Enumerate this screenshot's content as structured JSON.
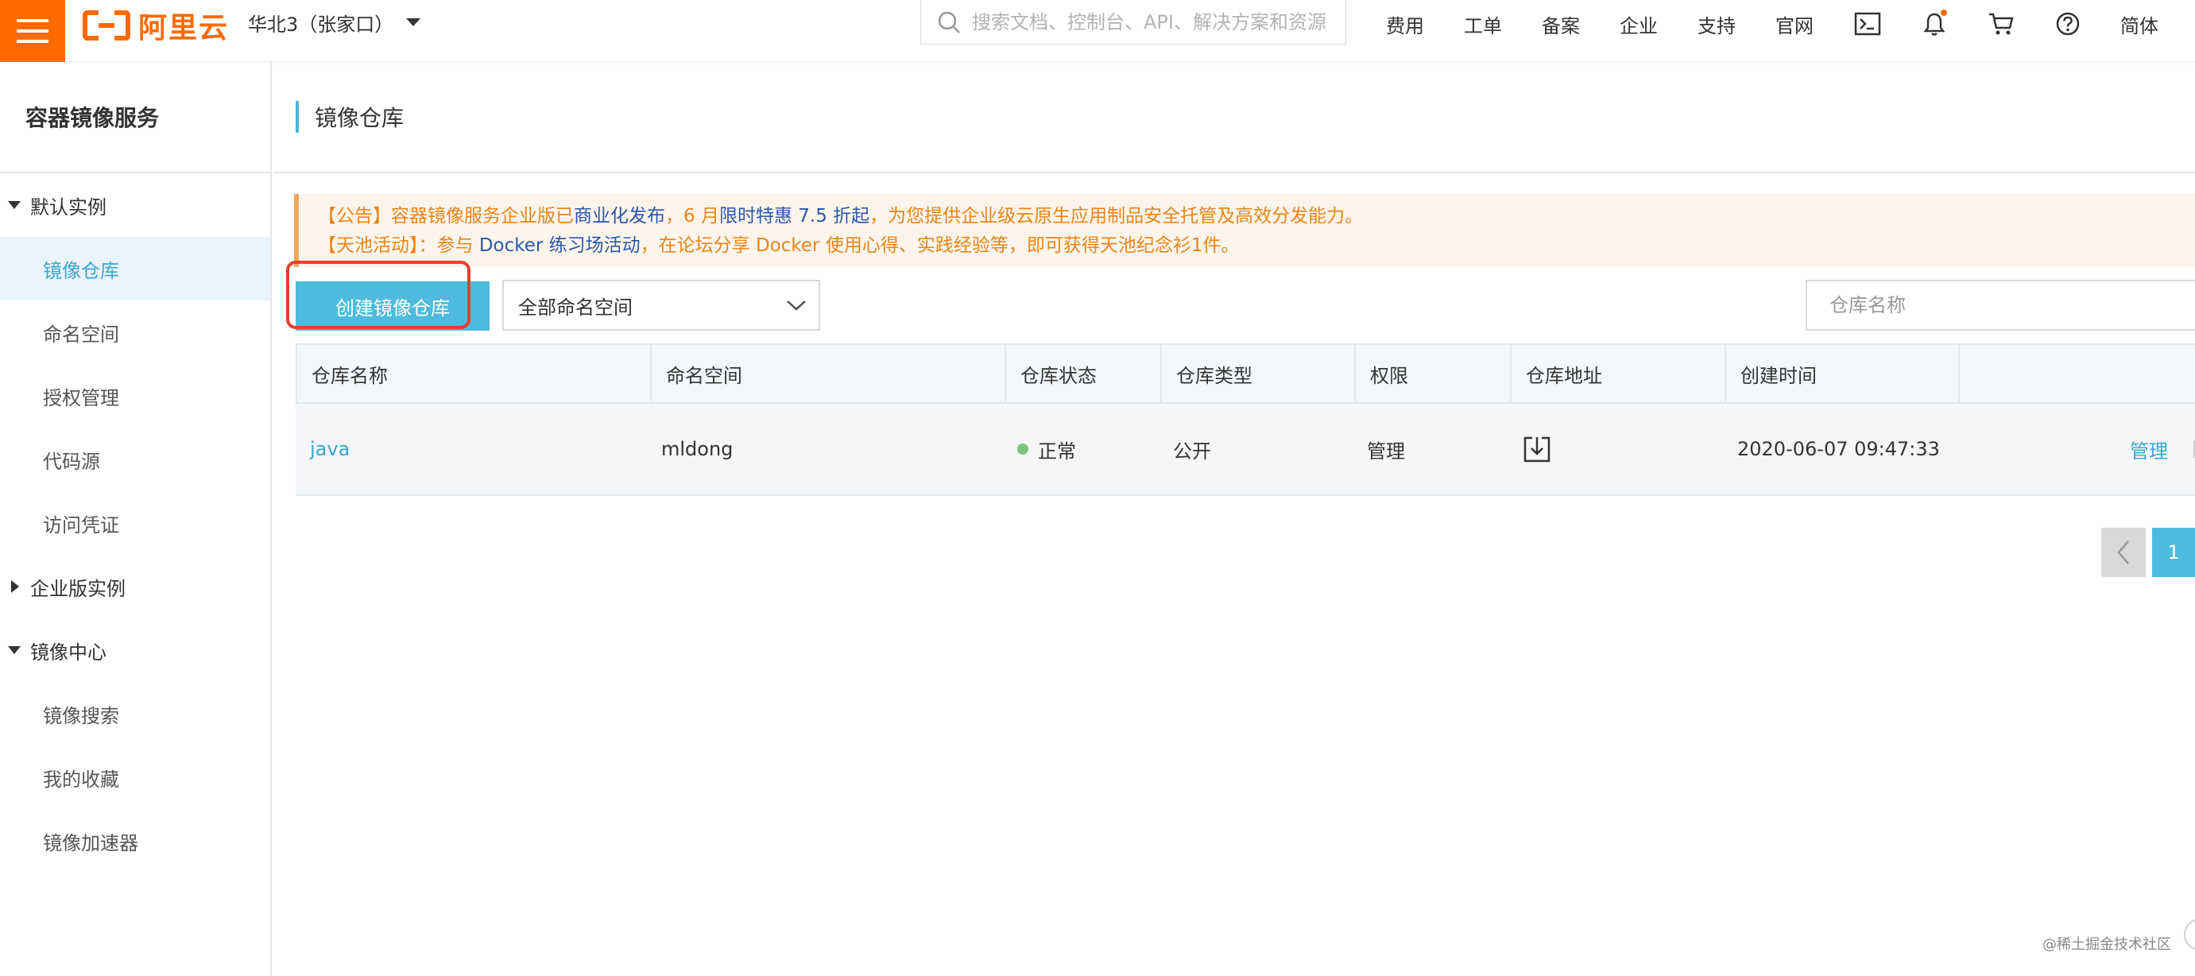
{
  "topbar": {
    "logo_text": "阿里云",
    "region": "华北3（张家口）",
    "search_placeholder": "搜索文档、控制台、API、解决方案和资源",
    "nav": [
      "费用",
      "工单",
      "备案",
      "企业",
      "支持",
      "官网"
    ],
    "icons": [
      "terminal-icon",
      "bell-icon",
      "cart-icon",
      "help-icon"
    ],
    "lang": "简体",
    "accent_color": "#ff6a00"
  },
  "sidebar": {
    "title": "容器镜像服务",
    "groups": [
      {
        "label": "默认实例",
        "expanded": true,
        "items": [
          "镜像仓库",
          "命名空间",
          "授权管理",
          "代码源",
          "访问凭证"
        ]
      },
      {
        "label": "企业版实例",
        "expanded": false,
        "items": []
      },
      {
        "label": "镜像中心",
        "expanded": true,
        "items": [
          "镜像搜索",
          "我的收藏",
          "镜像加速器"
        ]
      }
    ],
    "active_item": "镜像仓库"
  },
  "page": {
    "title": "镜像仓库"
  },
  "notice": {
    "line1": {
      "prefix": "【公告】容器镜像服务企业版已",
      "link1": "商业化发布",
      "mid1": "，6 月",
      "link2": "限时特惠 7.5 折起",
      "suffix": "，为您提供企业级云原生应用制品安全托管及高效分发能力。"
    },
    "line2": {
      "prefix": "【天池活动】：参与 ",
      "link": "Docker 练习场活动",
      "suffix": "，在论坛分享 Docker 使用心得、实践经验等，即可获得天池纪念衫1件。"
    }
  },
  "toolbar": {
    "create_label": "创建镜像仓库",
    "namespace_selected": "全部命名空间",
    "repo_search_placeholder": "仓库名称"
  },
  "table": {
    "columns": [
      "仓库名称",
      "命名空间",
      "仓库状态",
      "仓库类型",
      "权限",
      "仓库地址",
      "创建时间"
    ],
    "rows": [
      {
        "name": "java",
        "namespace": "mldong",
        "status": "正常",
        "type": "公开",
        "permission": "管理",
        "address_icon": "download-icon",
        "created": "2020-06-07 09:47:33",
        "action": "管理"
      }
    ]
  },
  "pagination": {
    "current_page": "1"
  },
  "watermark": "@稀土掘金技术社区"
}
